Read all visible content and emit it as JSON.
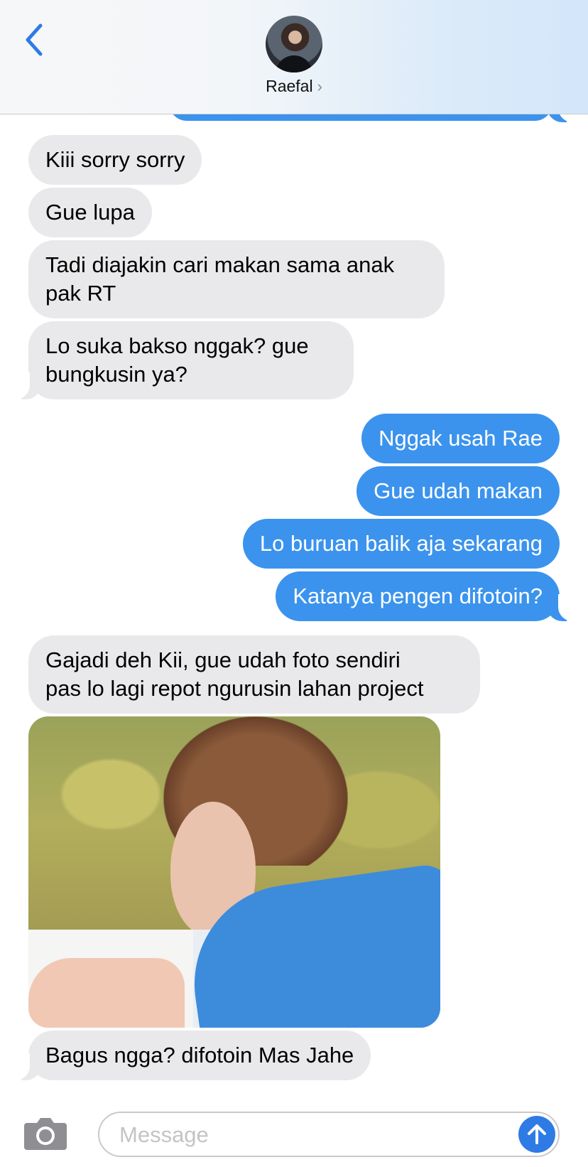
{
  "header": {
    "contact_name": "Raefal",
    "chevron": "›"
  },
  "colors": {
    "incoming_bubble": "#e9e9eb",
    "outgoing_bubble": "#3b93ed",
    "accent": "#2f7be5"
  },
  "messages": [
    {
      "from": "them",
      "text": "Kiii sorry sorry"
    },
    {
      "from": "them",
      "text": "Gue lupa"
    },
    {
      "from": "them",
      "lines": [
        "Tadi diajakin cari makan sama anak",
        "pak RT"
      ]
    },
    {
      "from": "them",
      "lines": [
        "Lo suka bakso nggak? gue",
        "bungkusin ya?"
      ]
    },
    {
      "from": "me",
      "text": "Nggak usah Rae"
    },
    {
      "from": "me",
      "text": "Gue udah makan"
    },
    {
      "from": "me",
      "text": "Lo buruan balik aja sekarang"
    },
    {
      "from": "me",
      "text": "Katanya pengen difotoin?"
    },
    {
      "from": "them",
      "lines": [
        "Gajadi deh Kii, gue udah foto sendiri",
        "pas lo lagi repot ngurusin lahan project"
      ]
    },
    {
      "from": "them",
      "type": "photo"
    },
    {
      "from": "them",
      "text": "Bagus ngga? difotoin Mas Jahe"
    }
  ],
  "composer": {
    "placeholder": "Message",
    "camera_icon": "camera-icon",
    "send_icon": "arrow-up-icon"
  }
}
